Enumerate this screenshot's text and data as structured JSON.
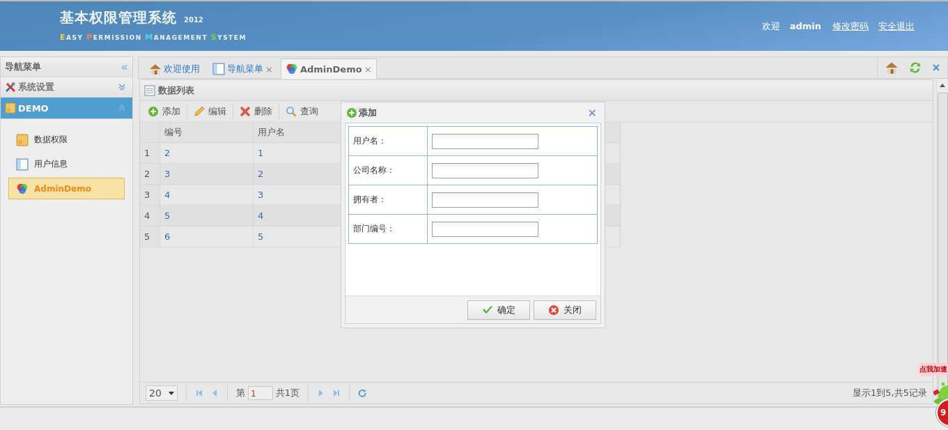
{
  "header": {
    "title": "基本权限管理系统",
    "year": "2012",
    "subtitle": [
      {
        "text": "EASY",
        "color": "#e8d840"
      },
      {
        "text": "PERMISSION",
        "color": "#f08a50"
      },
      {
        "text": "MANAGEMENT",
        "color": "#50d8e8"
      },
      {
        "text": "SYSTEM",
        "color": "#70d850"
      }
    ],
    "welcome": "欢迎",
    "user": "admin",
    "links": [
      "修改密码",
      "安全退出"
    ]
  },
  "sidebar": {
    "title": "导航菜单",
    "collapse": "«",
    "sections": [
      {
        "label": "系统设置",
        "expanded": false
      },
      {
        "label": "DEMO",
        "expanded": true,
        "items": [
          {
            "label": "数据权限",
            "selected": false
          },
          {
            "label": "用户信息",
            "selected": false
          },
          {
            "label": "AdminDemo",
            "selected": true
          }
        ]
      }
    ]
  },
  "tabs": [
    {
      "label": "欢迎使用",
      "selected": false
    },
    {
      "label": "导航菜单",
      "close": "×",
      "selected": false
    },
    {
      "label": "AdminDemo",
      "close": "×",
      "selected": true
    }
  ],
  "panel": {
    "title": "数据列表",
    "toolbar": [
      {
        "label": "添加"
      },
      {
        "label": "编辑"
      },
      {
        "label": "删除"
      },
      {
        "label": "查询"
      }
    ],
    "columns": [
      "编号",
      "用户名"
    ],
    "rows": [
      {
        "num": "1",
        "cells": [
          "2",
          "1"
        ]
      },
      {
        "num": "2",
        "cells": [
          "3",
          "2"
        ]
      },
      {
        "num": "3",
        "cells": [
          "4",
          "3"
        ]
      },
      {
        "num": "4",
        "cells": [
          "5",
          "4"
        ]
      },
      {
        "num": "5",
        "cells": [
          "6",
          "5"
        ]
      }
    ],
    "pager": {
      "page_size": "20",
      "page_before": "第",
      "page": "1",
      "page_after": "共1页",
      "info": "显示1到5,共5记录"
    }
  },
  "dialog": {
    "title": "添加",
    "close": "×",
    "fields": [
      {
        "label": "用户名："
      },
      {
        "label": "公司名称："
      },
      {
        "label": "拥有者："
      },
      {
        "label": "部门编号："
      }
    ],
    "buttons": [
      {
        "kind": "ok",
        "label": "确定"
      },
      {
        "kind": "cancel",
        "label": "关闭"
      }
    ]
  },
  "widget": {
    "bubble": "点我加速",
    "badge": "9"
  }
}
